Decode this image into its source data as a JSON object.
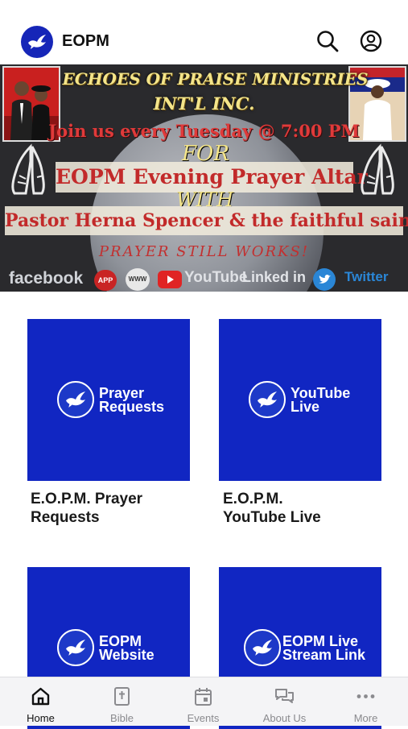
{
  "header": {
    "title": "EOPM",
    "search_icon": "search-icon",
    "profile_icon": "user-circle-icon"
  },
  "banner": {
    "line1": "ECHOES OF PRAISE MINISTRIES",
    "line2": "INT'L INC.",
    "line3": "Join us every Tuesday @ 7:00 PM",
    "for": "FOR",
    "event": "EOPM Evening Prayer Altar",
    "with": "WITH",
    "host": "Pastor Herna Spencer & the faithful saints",
    "tagline": "PRAYER STILL WORKS!",
    "social": {
      "facebook": "facebook",
      "app": "APP",
      "www": "WWW",
      "youtube": "YouTube",
      "linkedin": "Linked in",
      "twitter": "Twitter"
    }
  },
  "tiles": [
    {
      "badge_text_line1": "Prayer",
      "badge_text_line2": "Requests",
      "caption_line1": "E.O.P.M. Prayer",
      "caption_line2": "Requests"
    },
    {
      "badge_text_line1": "YouTube",
      "badge_text_line2": "Live",
      "caption_line1": "E.O.P.M.",
      "caption_line2": "YouTube Live"
    },
    {
      "badge_text_line1": "EOPM",
      "badge_text_line2": "Website"
    },
    {
      "badge_text_line1": "EOPM Live",
      "badge_text_line2": "Stream Link"
    }
  ],
  "bottom_nav": [
    {
      "label": "Home",
      "icon": "home-icon",
      "active": true
    },
    {
      "label": "Bible",
      "icon": "bible-icon",
      "active": false
    },
    {
      "label": "Events",
      "icon": "calendar-icon",
      "active": false
    },
    {
      "label": "About Us",
      "icon": "chat-bubbles-icon",
      "active": false
    },
    {
      "label": "More",
      "icon": "more-dots-icon",
      "active": false
    }
  ],
  "colors": {
    "brand_blue": "#1126c2",
    "nav_inactive": "#8a8a8e"
  }
}
